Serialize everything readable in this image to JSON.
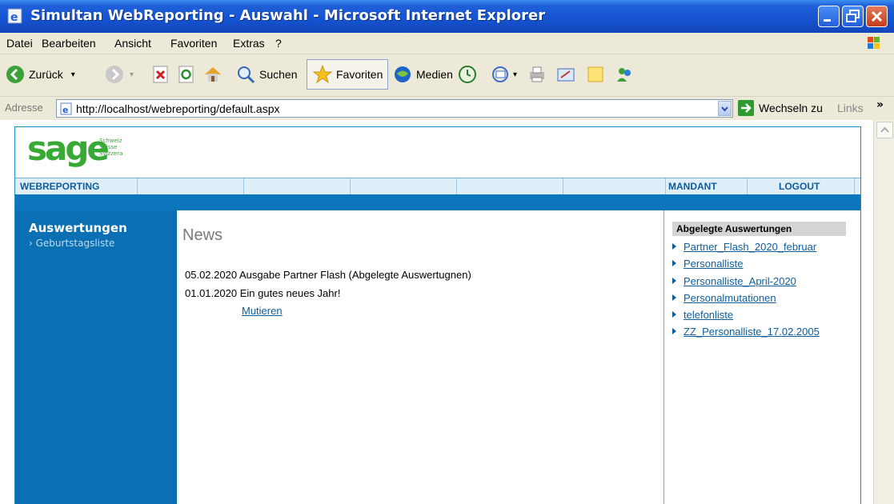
{
  "window": {
    "title": "Simultan WebReporting - Auswahl - Microsoft Internet Explorer"
  },
  "menu": {
    "items": [
      "Datei",
      "Bearbeiten",
      "Ansicht",
      "Favoriten",
      "Extras",
      "?"
    ]
  },
  "toolbar": {
    "back_label": "Zurück",
    "search_label": "Suchen",
    "favorites_label": "Favoriten",
    "media_label": "Medien"
  },
  "address": {
    "label": "Adresse",
    "url": "http://localhost/webreporting/default.aspx",
    "go_label": "Wechseln zu",
    "links_label": "Links"
  },
  "site": {
    "logo_text": "sage",
    "logo_sub": [
      "Schweiz",
      "Suisse",
      "Svizzera"
    ],
    "nav_left": "WEBREPORTING",
    "nav_mandant": "MANDANT",
    "nav_logout": "LOGOUT"
  },
  "left_panel": {
    "title": "Auswertungen",
    "items": [
      "› Geburtstagsliste"
    ]
  },
  "news": {
    "title": "News",
    "entries": [
      {
        "date": "05.02.2020",
        "text": "Ausgabe Partner Flash (Abgelegte Auswertugnen)"
      },
      {
        "date": "01.01.2020",
        "text": "Ein gutes neues Jahr!"
      }
    ],
    "edit_link": "Mutieren"
  },
  "right_panel": {
    "title": "Abgelegte Auswertungen",
    "items": [
      "Partner_Flash_2020_februar",
      "Personalliste",
      "Personalliste_April-2020",
      "Personalmutationen",
      "telefonliste",
      "ZZ_Personalliste_17.02.2005"
    ]
  },
  "colors": {
    "sage_green": "#39a935",
    "site_blue": "#0b6fb3",
    "xp_title_blue": "#1553d0"
  }
}
